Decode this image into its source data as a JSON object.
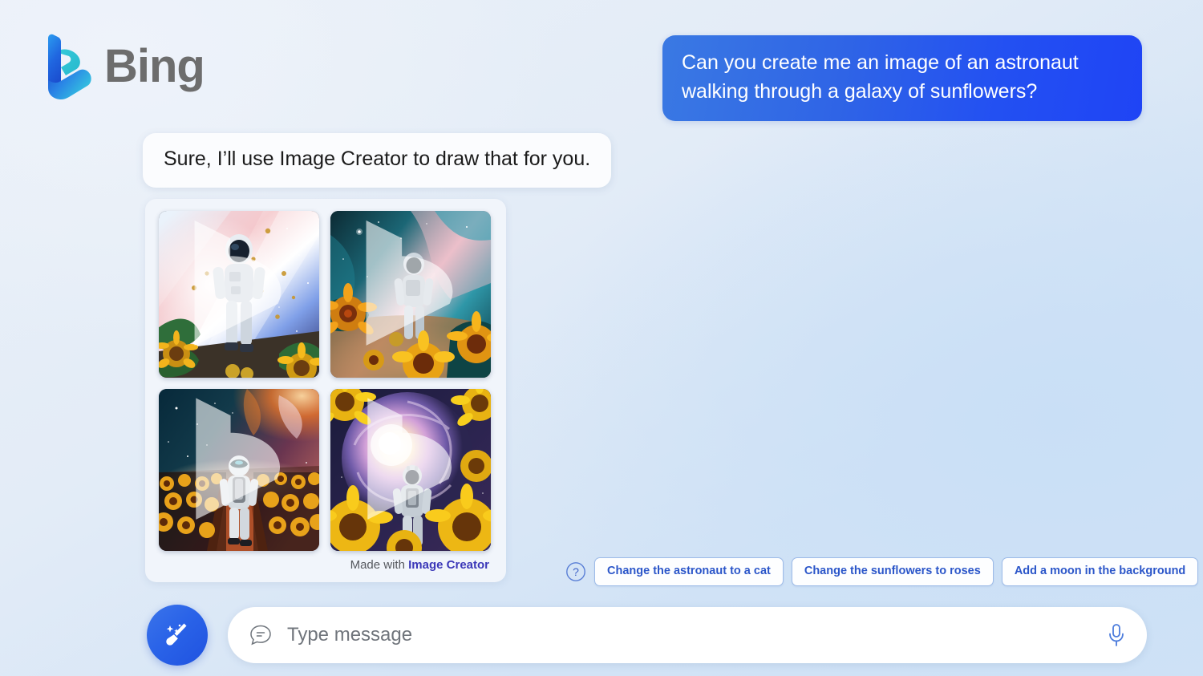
{
  "app": {
    "brand_name": "Bing",
    "brand_logo_icon": "bing-logo-icon",
    "background_color": "#dce8f7",
    "accent_color": "#2a5fe0"
  },
  "conversation": {
    "user_message": {
      "text": "Can you create me an image of an astronaut walking through a galaxy of sunflowers?",
      "bubble_color_start": "#3a79e3",
      "bubble_color_end": "#1f44f5"
    },
    "assistant_message": {
      "text": "Sure, I’ll use Image Creator to draw that for you."
    },
    "image_card": {
      "images": [
        {
          "alt": "Astronaut in white suit standing before a pink and blue nebula with sunflowers and green leaves in the foreground",
          "name": "generated-image-1"
        },
        {
          "alt": "Astronaut walking through a teal and pink cosmic sky above a field of large sunflowers",
          "name": "generated-image-2"
        },
        {
          "alt": "Astronaut seen from behind walking a path through a sunflower field under an orange nebula",
          "name": "generated-image-3"
        },
        {
          "alt": "Astronaut facing a bright spiral galaxy framed by giant yellow sunflowers",
          "name": "generated-image-4"
        }
      ],
      "footer_prefix": "Made with ",
      "footer_link": "Image Creator",
      "footer_link_color": "#3b38b8"
    }
  },
  "suggestions": {
    "help_icon": "question-circle-icon",
    "chips": [
      {
        "label": "Change the astronaut to a cat"
      },
      {
        "label": "Change the sunflowers to roses"
      },
      {
        "label": "Add a moon in the background"
      }
    ],
    "chip_text_color": "#2b56c9",
    "chip_border_color": "#9dbbe8"
  },
  "composer": {
    "new_topic_icon": "broom-sparkle-icon",
    "chat_icon": "chat-bubble-icon",
    "input_placeholder": "Type message",
    "input_value": "",
    "mic_icon": "microphone-icon"
  }
}
